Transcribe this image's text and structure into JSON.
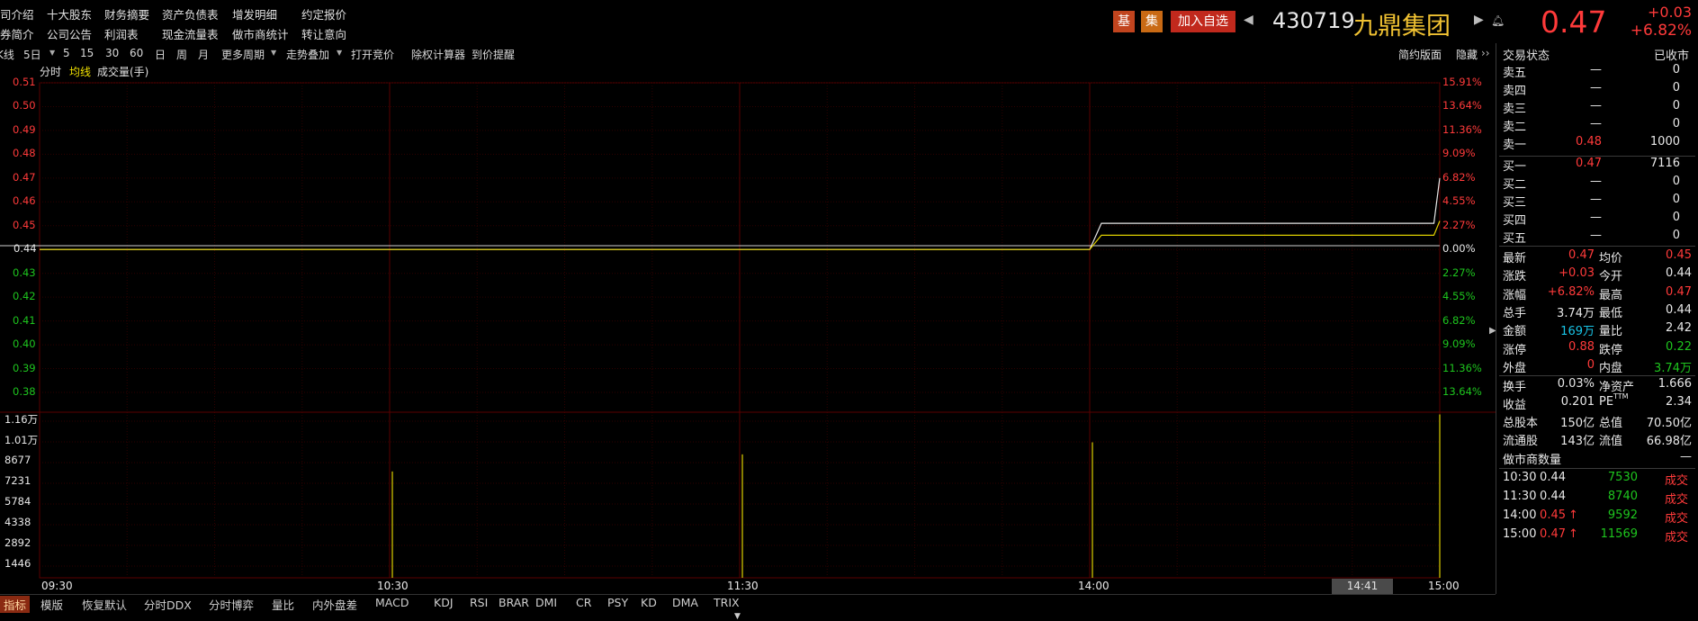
{
  "nav": {
    "row1": [
      "司介绍",
      "十大股东",
      "财务摘要",
      "资产负债表",
      "增发明细",
      "约定报价"
    ],
    "row2": [
      "券简介",
      "公司公告",
      "利润表",
      "现金流量表",
      "做市商统计",
      "转让意向"
    ]
  },
  "header": {
    "badge_ji": "基",
    "badge_ji2": "集",
    "add_watchlist": "加入自选",
    "code": "430719",
    "name": "九鼎集团",
    "price": "0.47",
    "change": "+0.03",
    "change_pct": "+6.82%"
  },
  "toolbar": {
    "items": [
      "K线",
      "5日",
      "5",
      "15",
      "30",
      "60",
      "日",
      "周",
      "月",
      "更多周期",
      "走势叠加",
      "打开竞价",
      "除权计算器",
      "到价提醒"
    ],
    "right": [
      "简约版面",
      "隐藏"
    ]
  },
  "chart": {
    "legend": [
      "分时",
      "均线",
      "成交量(手)"
    ],
    "left_price_labels": [
      "0.51",
      "0.50",
      "0.49",
      "0.48",
      "0.47",
      "0.46",
      "0.45",
      "0.44",
      "0.43",
      "0.42",
      "0.41",
      "0.40",
      "0.39",
      "0.38"
    ],
    "right_pct_labels": [
      "15.91%",
      "13.64%",
      "11.36%",
      "9.09%",
      "6.82%",
      "4.55%",
      "2.27%",
      "0.00%",
      "2.27%",
      "4.55%",
      "6.82%",
      "9.09%",
      "11.36%",
      "13.64%"
    ],
    "volume_labels": [
      "1.16万",
      "1.01万",
      "8677",
      "7231",
      "5784",
      "4338",
      "2892",
      "1446"
    ],
    "time_labels": [
      "09:30",
      "10:30",
      "11:30",
      "14:00",
      "15:00"
    ],
    "cursor_time": "14:41",
    "price_series": [
      {
        "t": "09:30",
        "price": 0.44
      },
      {
        "t": "14:00",
        "price": 0.44
      },
      {
        "t": "14:02",
        "price": 0.451
      },
      {
        "t": "14:59",
        "price": 0.451
      },
      {
        "t": "15:00",
        "price": 0.47
      }
    ],
    "avg_series": [
      {
        "t": "09:30",
        "price": 0.44
      },
      {
        "t": "14:00",
        "price": 0.44
      },
      {
        "t": "14:02",
        "price": 0.446
      },
      {
        "t": "14:59",
        "price": 0.446
      },
      {
        "t": "15:00",
        "price": 0.452
      }
    ],
    "volume_bars": [
      {
        "t": "10:30",
        "vol": 7530
      },
      {
        "t": "11:30",
        "vol": 8740
      },
      {
        "t": "14:00",
        "vol": 9592
      },
      {
        "t": "15:00",
        "vol": 11569
      }
    ]
  },
  "panel": {
    "status_label": "交易状态",
    "status_value": "已收市",
    "asks": [
      {
        "label": "卖五",
        "price": "—",
        "vol": "0"
      },
      {
        "label": "卖四",
        "price": "—",
        "vol": "0"
      },
      {
        "label": "卖三",
        "price": "—",
        "vol": "0"
      },
      {
        "label": "卖二",
        "price": "—",
        "vol": "0"
      },
      {
        "label": "卖一",
        "price": "0.48",
        "vol": "1000"
      }
    ],
    "bids": [
      {
        "label": "买一",
        "price": "0.47",
        "vol": "7116"
      },
      {
        "label": "买二",
        "price": "—",
        "vol": "0"
      },
      {
        "label": "买三",
        "price": "—",
        "vol": "0"
      },
      {
        "label": "买四",
        "price": "—",
        "vol": "0"
      },
      {
        "label": "买五",
        "price": "—",
        "vol": "0"
      }
    ],
    "stats": [
      {
        "l1": "最新",
        "v1": "0.47",
        "c1": "red",
        "l2": "均价",
        "v2": "0.45",
        "c2": "red"
      },
      {
        "l1": "涨跌",
        "v1": "+0.03",
        "c1": "red",
        "l2": "今开",
        "v2": "0.44",
        "c2": "white"
      },
      {
        "l1": "涨幅",
        "v1": "+6.82%",
        "c1": "red",
        "l2": "最高",
        "v2": "0.47",
        "c2": "red"
      },
      {
        "l1": "总手",
        "v1": "3.74万",
        "c1": "white",
        "l2": "最低",
        "v2": "0.44",
        "c2": "white"
      },
      {
        "l1": "金额",
        "v1": "169万",
        "c1": "cyan",
        "l2": "量比",
        "v2": "2.42",
        "c2": "white"
      },
      {
        "l1": "涨停",
        "v1": "0.88",
        "c1": "red",
        "l2": "跌停",
        "v2": "0.22",
        "c2": "green"
      },
      {
        "l1": "外盘",
        "v1": "0",
        "c1": "red",
        "l2": "内盘",
        "v2": "3.74万",
        "c2": "green"
      }
    ],
    "stats2": [
      {
        "l1": "换手",
        "v1": "0.03%",
        "l2": "净资产",
        "v2": "1.666"
      },
      {
        "l1": "收益",
        "v1": "0.201",
        "l2": "PE",
        "v2": "2.34"
      },
      {
        "l1": "总股本",
        "v1": "150亿",
        "l2": "总值",
        "v2": "70.50亿"
      },
      {
        "l1": "流通股",
        "v1": "143亿",
        "l2": "流值",
        "v2": "66.98亿"
      }
    ],
    "pe_sup": "TTM",
    "mm_label": "做市商数量",
    "mm_value": "—",
    "trades": [
      {
        "time": "10:30",
        "price": "0.44",
        "arrow": "",
        "vol": "7530",
        "type": "成交",
        "pc": "white"
      },
      {
        "time": "11:30",
        "price": "0.44",
        "arrow": "",
        "vol": "8740",
        "type": "成交",
        "pc": "white"
      },
      {
        "time": "14:00",
        "price": "0.45",
        "arrow": "↑",
        "vol": "9592",
        "type": "成交",
        "pc": "red"
      },
      {
        "time": "15:00",
        "price": "0.47",
        "arrow": "↑",
        "vol": "11569",
        "type": "成交",
        "pc": "red"
      }
    ]
  },
  "bottom_tabs": [
    "指标",
    "模版",
    "恢复默认",
    "分时DDX",
    "分时博弈",
    "量比",
    "内外盘差",
    "MACD",
    "KDJ",
    "RSI",
    "BRAR",
    "DMI",
    "CR",
    "PSY",
    "KD",
    "DMA",
    "TRIX"
  ],
  "colors": {
    "up": "#ff3a3a",
    "down": "#1ec51e",
    "price_line": "#e8e8e8",
    "avg_line": "#e0d000",
    "vol_bar": "#e0d000",
    "grid": "#3a0000"
  }
}
